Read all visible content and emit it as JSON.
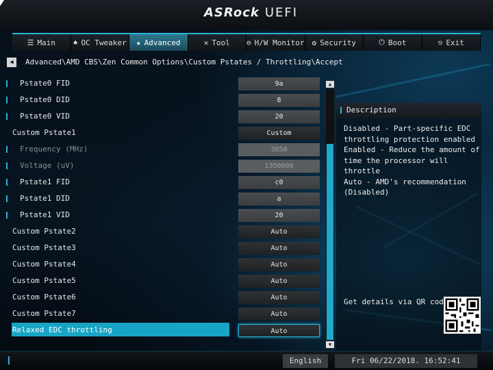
{
  "header": {
    "logo": "ASRock",
    "logo_suffix": "UEFI"
  },
  "tabs": [
    {
      "label": "Main",
      "icon": "list-icon",
      "glyph": "☰",
      "active": false
    },
    {
      "label": "OC Tweaker",
      "icon": "rocket-icon",
      "glyph": "♠",
      "active": false
    },
    {
      "label": "Advanced",
      "icon": "star-icon",
      "glyph": "★",
      "active": true
    },
    {
      "label": "Tool",
      "icon": "tools-icon",
      "glyph": "✕",
      "active": false
    },
    {
      "label": "H/W Monitor",
      "icon": "monitor-icon",
      "glyph": "⊖",
      "active": false
    },
    {
      "label": "Security",
      "icon": "shield-icon",
      "glyph": "✪",
      "active": false
    },
    {
      "label": "Boot",
      "icon": "power-icon",
      "glyph": "⏻",
      "active": false
    },
    {
      "label": "Exit",
      "icon": "exit-icon",
      "glyph": "⎋",
      "active": false
    }
  ],
  "breadcrumb": "Advanced\\AMD CBS\\Zen Common Options\\Custom Pstates / Throttling\\Accept",
  "settings": [
    {
      "label": "Pstate0 FID",
      "value": "9a",
      "indent": "sub",
      "state": "normal"
    },
    {
      "label": "Pstate0 DID",
      "value": "8",
      "indent": "sub",
      "state": "normal"
    },
    {
      "label": "Pstate0 VID",
      "value": "20",
      "indent": "sub",
      "state": "normal"
    },
    {
      "label": "Custom Pstate1",
      "value": "Custom",
      "indent": "top",
      "state": "dark"
    },
    {
      "label": "Frequency (MHz)",
      "value": "3850",
      "indent": "sub",
      "state": "disabled"
    },
    {
      "label": "Voltage (uV)",
      "value": "1350000",
      "indent": "sub",
      "state": "disabled"
    },
    {
      "label": "Pstate1 FID",
      "value": "c0",
      "indent": "sub",
      "state": "normal"
    },
    {
      "label": "Pstate1 DID",
      "value": "a",
      "indent": "sub",
      "state": "normal"
    },
    {
      "label": "Pstate1 VID",
      "value": "20",
      "indent": "sub",
      "state": "normal"
    },
    {
      "label": "Custom Pstate2",
      "value": "Auto",
      "indent": "top",
      "state": "dark"
    },
    {
      "label": "Custom Pstate3",
      "value": "Auto",
      "indent": "top",
      "state": "dark"
    },
    {
      "label": "Custom Pstate4",
      "value": "Auto",
      "indent": "top",
      "state": "dark"
    },
    {
      "label": "Custom Pstate5",
      "value": "Auto",
      "indent": "top",
      "state": "dark"
    },
    {
      "label": "Custom Pstate6",
      "value": "Auto",
      "indent": "top",
      "state": "dark"
    },
    {
      "label": "Custom Pstate7",
      "value": "Auto",
      "indent": "top",
      "state": "dark"
    },
    {
      "label": "Relaxed EDC throttling",
      "value": "Auto",
      "indent": "top",
      "state": "selected"
    }
  ],
  "description": {
    "title": "Description",
    "text": "Disabled - Part-specific EDC\nthrottling protection enabled\nEnabled - Reduce the amount of\ntime the processor will throttle\nAuto - AMD's recommendation\n(Disabled)",
    "qr_label": "Get details via QR code"
  },
  "footer": {
    "language": "English",
    "datetime": "Fri 06/22/2018. 16:52:41"
  },
  "colors": {
    "accent": "#2bb2d6",
    "selected": "#18a5c5"
  }
}
